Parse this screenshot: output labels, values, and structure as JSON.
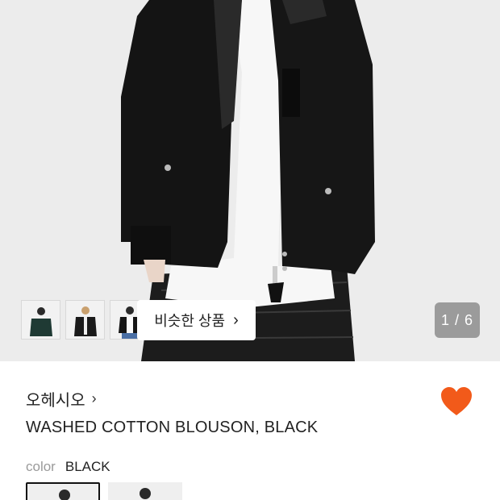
{
  "gallery": {
    "pager": "1 / 6",
    "similar_button": "비슷한 상품",
    "thumbnails": [
      "thumb-green-jacket",
      "thumb-black-jacket-front",
      "thumb-black-jacket-white-shirt"
    ]
  },
  "product": {
    "brand": "오헤시오",
    "title": "WASHED COTTON BLOUSON, BLACK",
    "color_label": "color",
    "color_value": "BLACK",
    "favorite_color": "#f25a1a"
  },
  "icons": {
    "brand_chevron": "chevron-right-icon",
    "similar_chevron": "chevron-right-icon",
    "favorite": "heart-icon"
  }
}
